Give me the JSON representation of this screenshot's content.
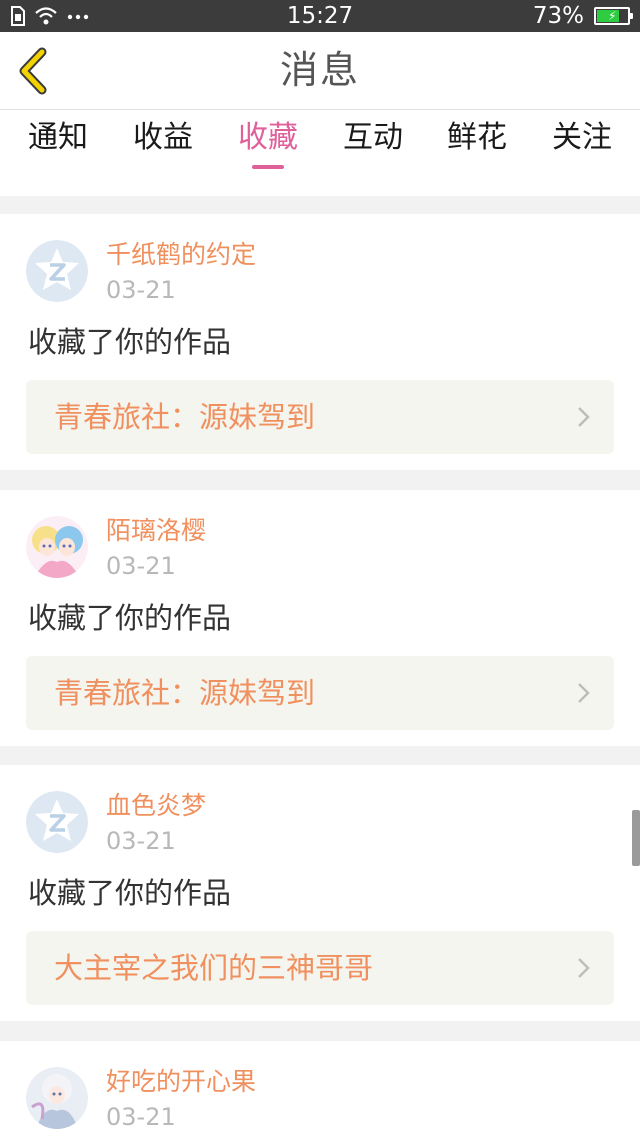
{
  "status_bar": {
    "time": "15:27",
    "battery_percent": "73%",
    "battery_level": 0.73
  },
  "header": {
    "title": "消息"
  },
  "tabs": [
    {
      "label": "通知",
      "active": false
    },
    {
      "label": "收益",
      "active": false
    },
    {
      "label": "收藏",
      "active": true
    },
    {
      "label": "互动",
      "active": false
    },
    {
      "label": "鲜花",
      "active": false
    },
    {
      "label": "关注",
      "active": false
    }
  ],
  "messages": [
    {
      "user": "千纸鹤的约定",
      "date": "03-21",
      "action": "收藏了你的作品",
      "work": "青春旅社：源妹驾到",
      "avatar": "default-avatar-icon"
    },
    {
      "user": "陌璃洛樱",
      "date": "03-21",
      "action": "收藏了你的作品",
      "work": "青春旅社：源妹驾到",
      "avatar": "anime-avatar"
    },
    {
      "user": "血色炎梦",
      "date": "03-21",
      "action": "收藏了你的作品",
      "work": "大主宰之我们的三神哥哥",
      "avatar": "default-avatar-icon"
    },
    {
      "user": "好吃的开心果",
      "date": "03-21",
      "action": "",
      "work": "",
      "avatar": "anime-avatar"
    }
  ],
  "colors": {
    "accent_pink": "#e0609a",
    "name_orange": "#f0905e",
    "date_gray": "#b8b8b8",
    "status_bar_bg": "#3c3c3c"
  }
}
